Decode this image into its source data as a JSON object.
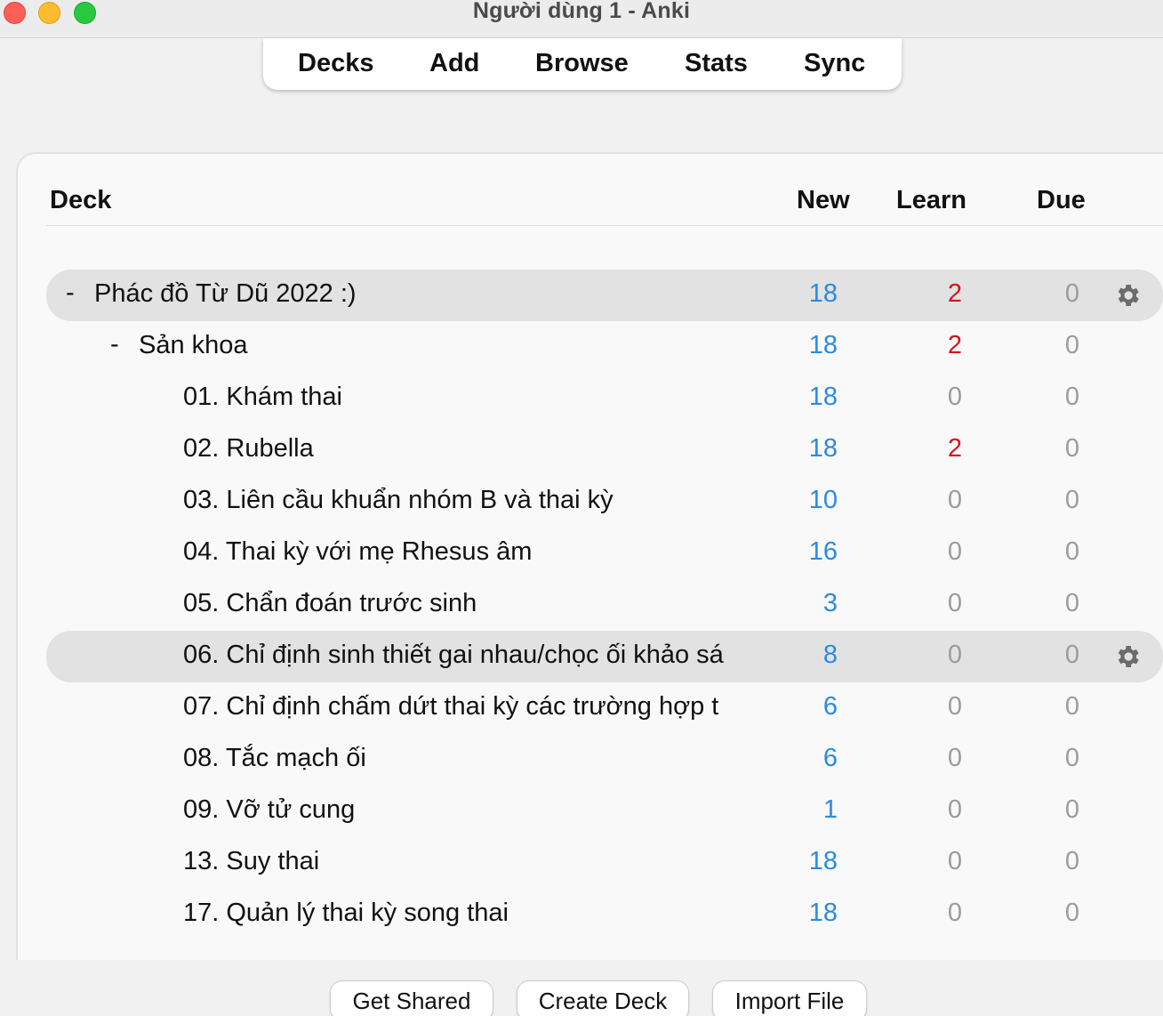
{
  "window": {
    "title": "Người dùng 1 - Anki"
  },
  "toolbar": {
    "decks": "Decks",
    "add": "Add",
    "browse": "Browse",
    "stats": "Stats",
    "sync": "Sync"
  },
  "table": {
    "headers": {
      "deck": "Deck",
      "new": "New",
      "learn": "Learn",
      "due": "Due"
    },
    "rows": [
      {
        "collapse": "-",
        "name": "Phác đồ Từ Dũ 2022 :)",
        "new": "18",
        "learn": "2",
        "due": "0"
      },
      {
        "collapse": "-",
        "name": "Sản khoa",
        "new": "18",
        "learn": "2",
        "due": "0"
      },
      {
        "name": "01. Khám thai",
        "new": "18",
        "learn": "0",
        "due": "0"
      },
      {
        "name": "02. Rubella",
        "new": "18",
        "learn": "2",
        "due": "0"
      },
      {
        "name": "03. Liên cầu khuẩn nhóm B và thai kỳ",
        "new": "10",
        "learn": "0",
        "due": "0"
      },
      {
        "name": "04. Thai kỳ với mẹ Rhesus âm",
        "new": "16",
        "learn": "0",
        "due": "0"
      },
      {
        "name": "05. Chẩn đoán trước sinh",
        "new": "3",
        "learn": "0",
        "due": "0"
      },
      {
        "name": "06. Chỉ định sinh thiết gai nhau/chọc ối khảo sá",
        "new": "8",
        "learn": "0",
        "due": "0"
      },
      {
        "name": "07. Chỉ định chấm dứt thai kỳ các trường hợp t",
        "new": "6",
        "learn": "0",
        "due": "0"
      },
      {
        "name": "08. Tắc mạch ối",
        "new": "6",
        "learn": "0",
        "due": "0"
      },
      {
        "name": "09. Vỡ tử cung",
        "new": "1",
        "learn": "0",
        "due": "0"
      },
      {
        "name": "13. Suy thai",
        "new": "18",
        "learn": "0",
        "due": "0"
      },
      {
        "name": "17. Quản lý thai kỳ song thai",
        "new": "18",
        "learn": "0",
        "due": "0"
      }
    ]
  },
  "bottom": {
    "get_shared": "Get Shared",
    "create_deck": "Create Deck",
    "import_file": "Import File"
  },
  "colors": {
    "new": "#2b8ae2",
    "learn": "#d8131b",
    "zero": "#9c9c9c"
  },
  "icons": {
    "options": "gear-icon"
  }
}
